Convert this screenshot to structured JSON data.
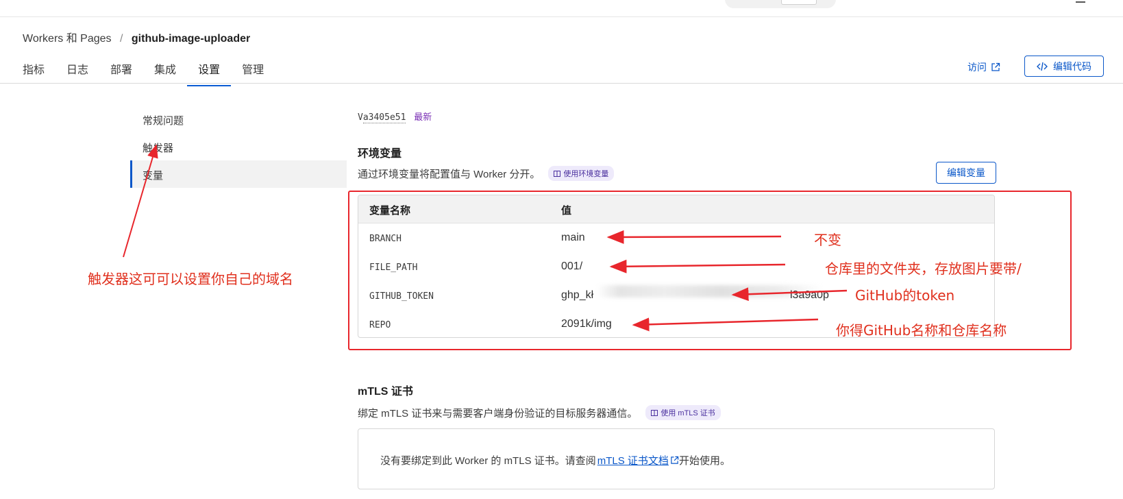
{
  "breadcrumb": {
    "root": "Workers 和 Pages",
    "separator": "/",
    "project": "github-image-uploader"
  },
  "tabs": [
    {
      "label": "指标"
    },
    {
      "label": "日志"
    },
    {
      "label": "部署"
    },
    {
      "label": "集成"
    },
    {
      "label": "设置",
      "active": true
    },
    {
      "label": "管理"
    }
  ],
  "header": {
    "visit_label": "访问",
    "edit_code_label": "编辑代码",
    "edit_code_icon": "code-icon",
    "visit_icon": "external-link-icon"
  },
  "sidebar": {
    "items": [
      {
        "label": "常规问题"
      },
      {
        "label": "触发器"
      },
      {
        "label": "变量",
        "active": true
      }
    ]
  },
  "version": {
    "id": "a3405e51",
    "prefix": "V",
    "badge": "最新"
  },
  "env": {
    "title": "环境变量",
    "description": "通过环境变量将配置值与 Worker 分开。",
    "doc_pill": "使用环境变量",
    "edit_button": "编辑变量",
    "columns": [
      "变量名称",
      "值"
    ],
    "rows": [
      {
        "name": "BRANCH",
        "value": "main"
      },
      {
        "name": "FILE_PATH",
        "value": "001/"
      },
      {
        "name": "GITHUB_TOKEN",
        "value_start": "ghp_kł",
        "value_end": "l3a9a0p",
        "redacted": true
      },
      {
        "name": "REPO",
        "value": "2091k/img"
      }
    ]
  },
  "annotations": {
    "trigger_note": "触发器这可可以设置你自己的域名",
    "branch_note": "不变",
    "file_path_note": "仓库里的文件夹，存放图片要带/",
    "token_note": "GitHub的token",
    "repo_note": "你得GitHub名称和仓库名称",
    "annotation_color": "#e0301e"
  },
  "mtls": {
    "title": "mTLS 证书",
    "description": "绑定 mTLS 证书来与需要客户端身份验证的目标服务器通信。",
    "doc_pill": "使用 mTLS 证书",
    "empty_text_before": "没有要绑定到此 Worker 的 mTLS 证书。请查阅",
    "link_text": "mTLS 证书文档",
    "empty_text_after": "开始使用。"
  },
  "colors": {
    "accent": "#0a57c9",
    "annotation_red": "#e8262c",
    "badge_purple": "#7a2fb5"
  }
}
